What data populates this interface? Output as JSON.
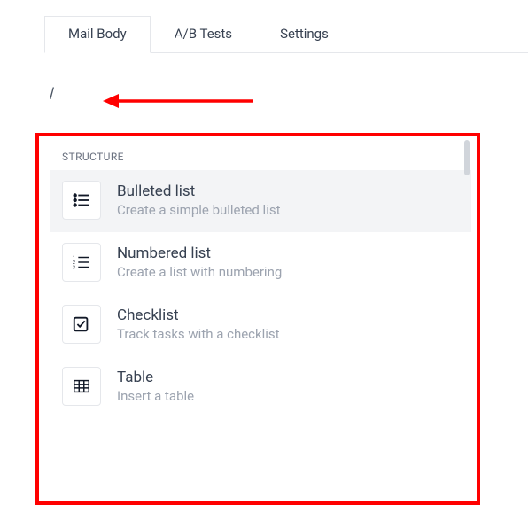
{
  "tabs": {
    "items": [
      {
        "label": "Mail Body",
        "active": true
      },
      {
        "label": "A/B Tests",
        "active": false
      },
      {
        "label": "Settings",
        "active": false
      }
    ]
  },
  "editor": {
    "slash_command": "/"
  },
  "popover": {
    "section_header": "STRUCTURE",
    "items": [
      {
        "icon": "bulleted-list-icon",
        "title": "Bulleted list",
        "desc": "Create a simple bulleted list",
        "highlighted": true
      },
      {
        "icon": "numbered-list-icon",
        "title": "Numbered list",
        "desc": "Create a list with numbering",
        "highlighted": false
      },
      {
        "icon": "checklist-icon",
        "title": "Checklist",
        "desc": "Track tasks with a checklist",
        "highlighted": false
      },
      {
        "icon": "table-icon",
        "title": "Table",
        "desc": "Insert a table",
        "highlighted": false
      }
    ]
  },
  "annotation": {
    "arrow_color": "#ff0000",
    "box_color": "#ff0000"
  }
}
